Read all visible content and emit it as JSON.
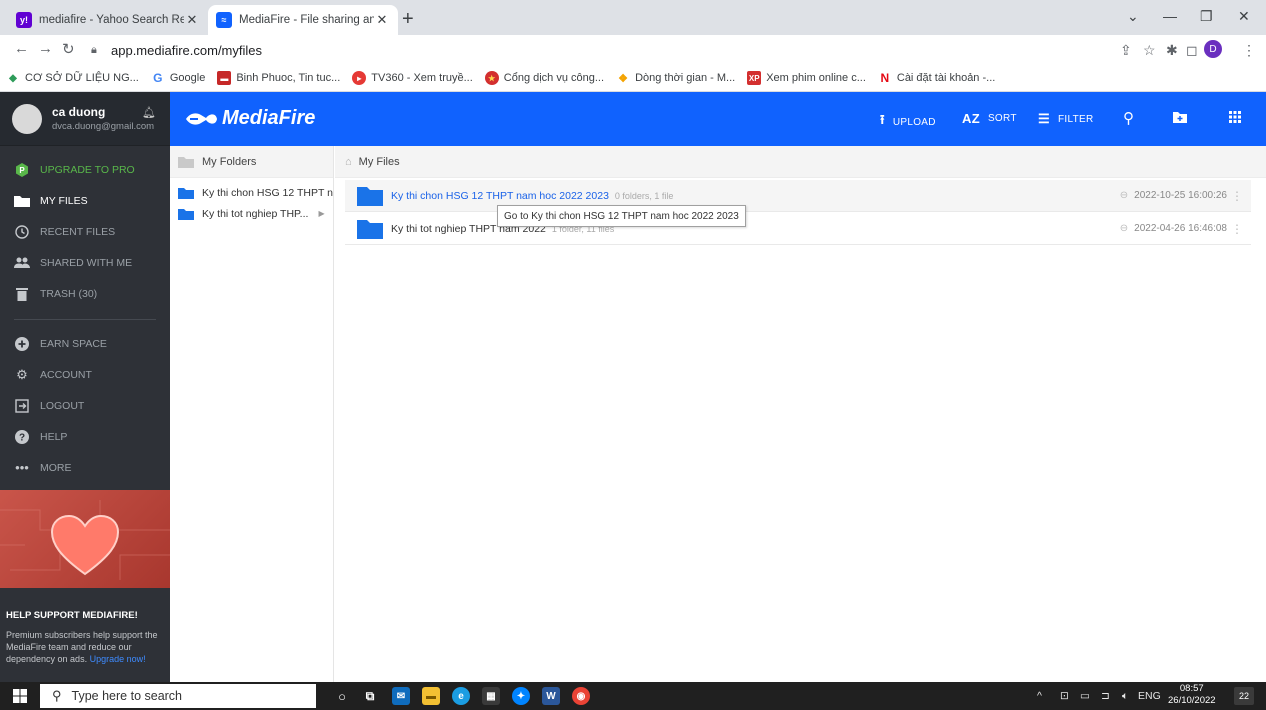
{
  "browser": {
    "tabs": [
      {
        "title": "mediafire - Yahoo Search Results",
        "icon": "yahoo-icon",
        "active": false
      },
      {
        "title": "MediaFire - File sharing and stora",
        "icon": "mediafire-icon",
        "active": true
      }
    ],
    "address": "app.mediafire.com/myfiles",
    "profile_initial": "D",
    "bookmarks": [
      {
        "label": "CƠ SỞ DỮ LIỆU NG...",
        "icon": "diamond-icon",
        "color": "#2e9c5a"
      },
      {
        "label": "Google",
        "icon": "google-icon",
        "color": "#4285f4"
      },
      {
        "label": "Binh Phuoc, Tin tuc...",
        "icon": "news-icon",
        "color": "#c62828"
      },
      {
        "label": "TV360 - Xem truyề...",
        "icon": "tv360-icon",
        "color": "#e53935"
      },
      {
        "label": "Cổng dịch vụ công...",
        "icon": "emblem-icon",
        "color": "#d32f2f"
      },
      {
        "label": "Dòng thời gian - M...",
        "icon": "timeline-icon",
        "color": "#f4a300"
      },
      {
        "label": "Xem phim online c...",
        "icon": "xp-icon",
        "color": "#d32f2f"
      },
      {
        "label": "Cài đặt tài khoản -...",
        "icon": "netflix-icon",
        "color": "#e50914"
      }
    ]
  },
  "user": {
    "name": "ca duong",
    "email": "dvca.duong@gmail.com"
  },
  "sidebar": {
    "items": [
      {
        "label": "UPGRADE TO PRO",
        "icon": "pro-badge-icon"
      },
      {
        "label": "MY FILES",
        "icon": "folder-icon"
      },
      {
        "label": "RECENT FILES",
        "icon": "clock-icon"
      },
      {
        "label": "SHARED WITH ME",
        "icon": "people-icon"
      },
      {
        "label": "TRASH (30)",
        "icon": "trash-icon"
      },
      {
        "label": "EARN SPACE",
        "icon": "plus-circle-icon"
      },
      {
        "label": "ACCOUNT",
        "icon": "gear-icon"
      },
      {
        "label": "LOGOUT",
        "icon": "logout-icon"
      },
      {
        "label": "HELP",
        "icon": "help-icon"
      },
      {
        "label": "MORE",
        "icon": "more-icon"
      }
    ],
    "promo": {
      "heading": "HELP SUPPORT MEDIAFIRE!",
      "text": "Premium subscribers help support the MediaFire team and reduce our dependency on ads.",
      "link": "Upgrade now!"
    }
  },
  "header": {
    "logo": "MediaFire",
    "upload": "UPLOAD",
    "sort": "SORT",
    "filter": "FILTER"
  },
  "folder_pane": {
    "title": "My Folders",
    "items": [
      "Ky thi chon HSG 12 THPT n...",
      "Ky thi tot nghiep THP..."
    ]
  },
  "main": {
    "breadcrumb": "My Files",
    "rows": [
      {
        "name": "Ky thi chon HSG 12 THPT nam hoc 2022 2023",
        "meta": "0 folders, 1 file",
        "date": "2022-10-25 16:00:26"
      },
      {
        "name": "Ky thi tot nghiep THPT nam 2022",
        "meta": "1 folder, 11 files",
        "date": "2022-04-26 16:46:08"
      }
    ],
    "tooltip": "Go to Ky thi chon HSG 12 THPT nam hoc 2022 2023"
  },
  "taskbar": {
    "search_placeholder": "Type here to search",
    "lang": "ENG",
    "time": "08:57",
    "date": "26/10/2022",
    "notifications": "22"
  },
  "colors": {
    "accent": "#1062fe",
    "sidebar": "#2e3137",
    "pro": "#59b74a"
  }
}
